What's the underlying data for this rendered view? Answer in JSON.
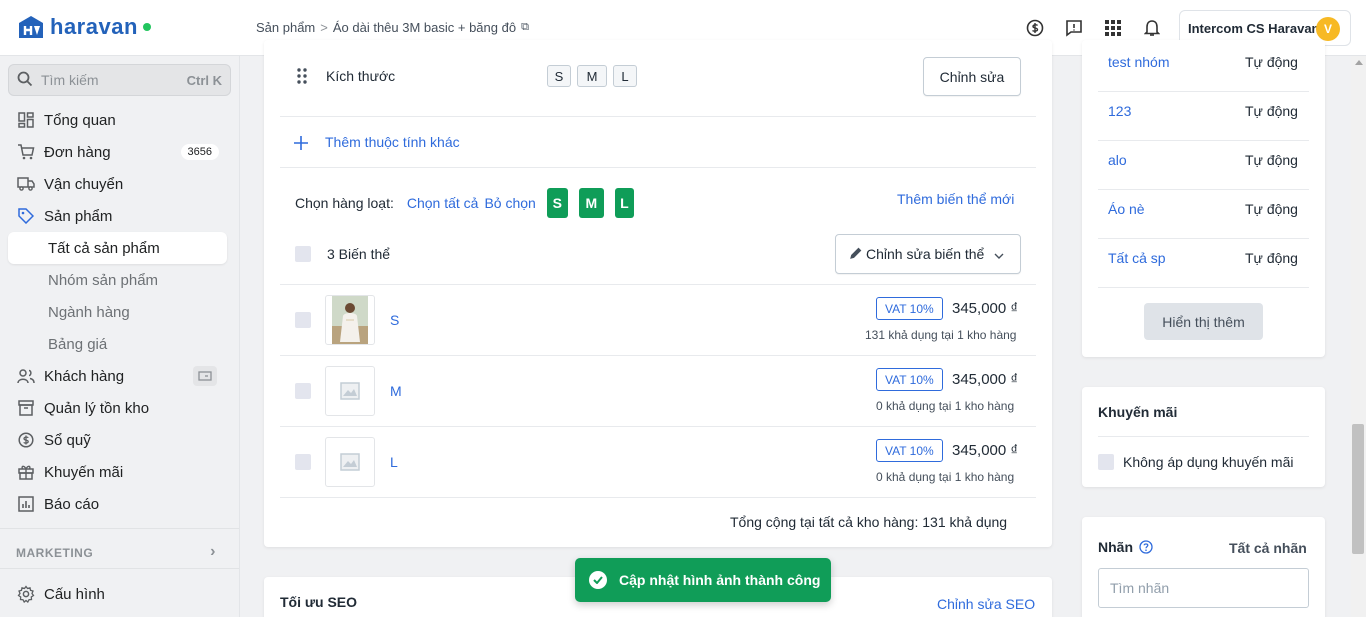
{
  "header": {
    "logo_text": "haravan",
    "breadcrumb_root": "Sản phẩm",
    "breadcrumb_sep": ">",
    "breadcrumb_current": "Áo dài thêu 3M basic + băng đô",
    "account_name": "Intercom CS Haravan",
    "avatar_letter": "V"
  },
  "sidebar": {
    "search_placeholder": "Tìm kiếm",
    "search_shortcut": "Ctrl K",
    "items": [
      {
        "label": "Tổng quan",
        "icon": "dashboard-icon"
      },
      {
        "label": "Đơn hàng",
        "icon": "cart-icon",
        "badge": "3656"
      },
      {
        "label": "Vận chuyển",
        "icon": "truck-icon"
      },
      {
        "label": "Sản phẩm",
        "icon": "tag-icon"
      }
    ],
    "product_sub": [
      "Tất cả sản phẩm",
      "Nhóm sản phẩm",
      "Ngành hàng",
      "Bảng giá"
    ],
    "items2": [
      {
        "label": "Khách hàng",
        "icon": "users-icon"
      },
      {
        "label": "Quản lý tồn kho",
        "icon": "inventory-icon"
      },
      {
        "label": "Sổ quỹ",
        "icon": "cashbook-icon"
      },
      {
        "label": "Khuyến mãi",
        "icon": "gift-icon"
      },
      {
        "label": "Báo cáo",
        "icon": "report-icon"
      }
    ],
    "marketing_label": "MARKETING",
    "settings_label": "Cấu hình"
  },
  "variants_card": {
    "option_name": "Kích thước",
    "option_values": [
      "S",
      "M",
      "L"
    ],
    "edit_button": "Chỉnh sửa",
    "add_attribute": "Thêm thuộc tính khác",
    "bulk_select_label": "Chọn hàng loạt:",
    "select_all": "Chọn tất cả",
    "deselect": "Bỏ chọn",
    "bulk_values": [
      "S",
      "M",
      "L"
    ],
    "add_variant": "Thêm biến thể mới",
    "variant_count": "3 Biến thể",
    "edit_variants_button": "Chỉnh sửa biến thể",
    "rows": [
      {
        "name": "S",
        "vat": "VAT 10%",
        "price": "345,000 ₫",
        "available": "131 khả dụng tại 1 kho hàng"
      },
      {
        "name": "M",
        "vat": "VAT 10%",
        "price": "345,000 ₫",
        "available": "0 khả dụng tại 1 kho hàng"
      },
      {
        "name": "L",
        "vat": "VAT 10%",
        "price": "345,000 ₫",
        "available": "0 khả dụng tại 1 kho hàng"
      }
    ],
    "total": "Tổng cộng tại tất cả kho hàng: 131 khả dụng"
  },
  "seo": {
    "title": "Tối ưu SEO",
    "edit_link": "Chỉnh sửa SEO"
  },
  "collections": {
    "rows": [
      {
        "name": "test nhóm",
        "type": "Tự động"
      },
      {
        "name": "123",
        "type": "Tự động"
      },
      {
        "name": "alo",
        "type": "Tự động"
      },
      {
        "name": "Áo nè",
        "type": "Tự động"
      },
      {
        "name": "Tất cả sp",
        "type": "Tự động"
      }
    ],
    "show_more": "Hiển thị thêm"
  },
  "promotion": {
    "title": "Khuyến mãi",
    "checkbox_label": "Không áp dụng khuyến mãi"
  },
  "tags": {
    "title": "Nhãn",
    "all_tags": "Tất cả nhãn",
    "input_placeholder": "Tìm nhãn"
  },
  "toast": {
    "message": "Cập nhật hình ảnh thành công"
  },
  "colors": {
    "brand": "#2362ba",
    "link": "#2f6bdc",
    "success": "#0f9d58"
  }
}
